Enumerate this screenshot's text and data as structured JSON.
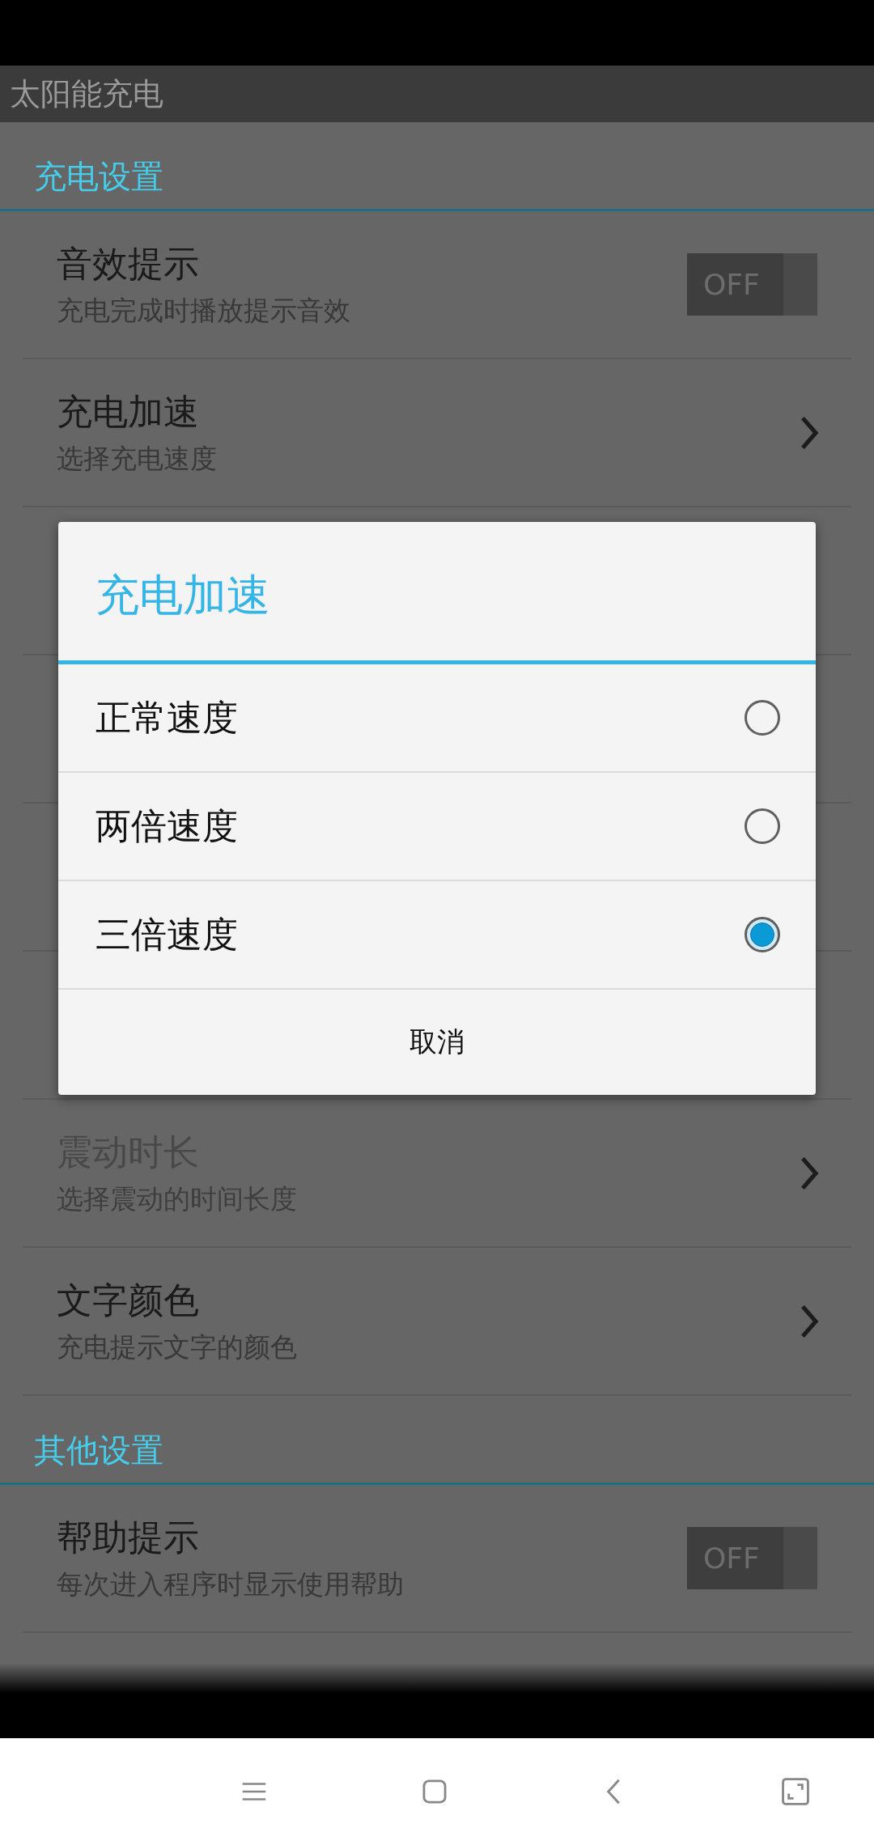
{
  "app_bar": {
    "title": "太阳能充电"
  },
  "sections": [
    {
      "title": "充电设置",
      "items": [
        {
          "kind": "toggle",
          "title": "音效提示",
          "subtitle": "充电完成时播放提示音效",
          "on": false,
          "toggle_label": "OFF",
          "disabled": false
        },
        {
          "kind": "link",
          "title": "充电加速",
          "subtitle": "选择充电速度",
          "disabled": false
        },
        {
          "kind": "link",
          "title": "震动时长",
          "subtitle": "选择震动的时间长度",
          "disabled": true
        },
        {
          "kind": "link",
          "title": "文字颜色",
          "subtitle": "充电提示文字的颜色",
          "disabled": false
        }
      ]
    },
    {
      "title": "其他设置",
      "items": [
        {
          "kind": "toggle",
          "title": "帮助提示",
          "subtitle": "每次进入程序时显示使用帮助",
          "on": false,
          "toggle_label": "OFF",
          "disabled": false
        }
      ]
    }
  ],
  "dialog": {
    "title": "充电加速",
    "options": [
      {
        "label": "正常速度",
        "selected": false
      },
      {
        "label": "两倍速度",
        "selected": false
      },
      {
        "label": "三倍速度",
        "selected": true
      }
    ],
    "cancel": "取消"
  }
}
